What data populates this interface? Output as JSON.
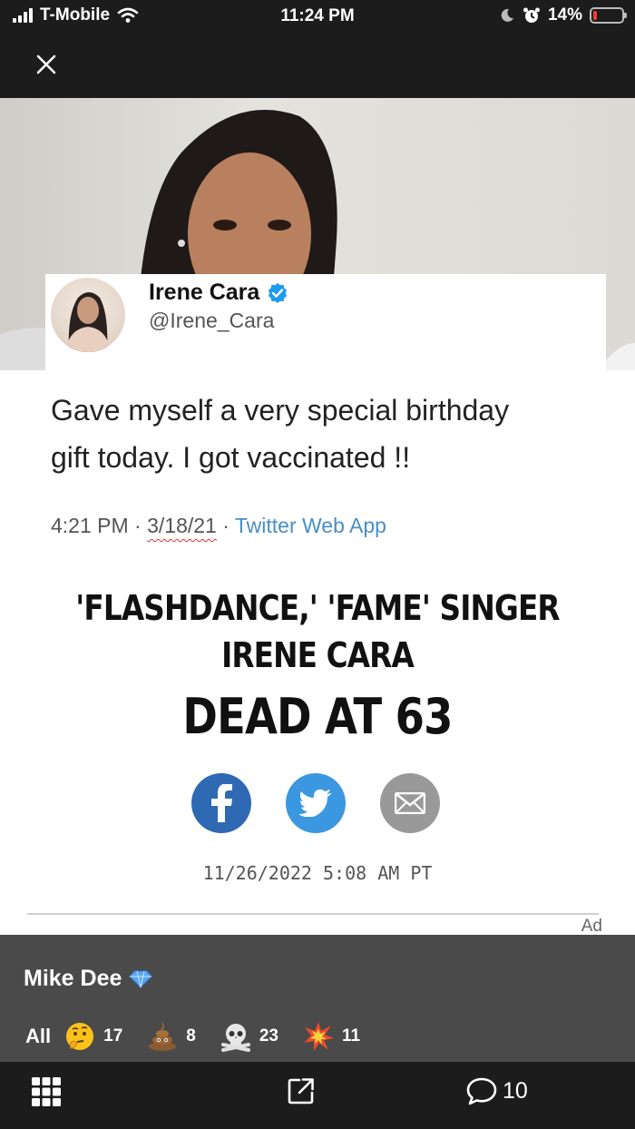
{
  "status_bar": {
    "carrier": "T-Mobile",
    "time": "11:24 PM",
    "battery_percent": "14%",
    "battery_level": 0.14
  },
  "top_bar": {
    "close_icon": "close-icon"
  },
  "image": {
    "tweet": {
      "name": "Irene Cara",
      "handle": "@Irene_Cara",
      "text_line1": "Gave myself a very special birthday",
      "text_line2": "gift today. I got vaccinated !!",
      "time": "4:21 PM",
      "sep1": " · ",
      "date": "3/18/21",
      "sep2": " · ",
      "source": "Twitter Web App"
    },
    "headline": {
      "line1": "'FLASHDANCE,' 'FAME' SINGER",
      "line2": "IRENE CARA",
      "line3": "DEAD AT 63"
    },
    "share_icons": [
      "facebook-icon",
      "twitter-icon",
      "mail-icon"
    ],
    "article_date": "11/26/2022 5:08 AM PT",
    "ad_label": "Ad"
  },
  "post": {
    "poster_name": "Mike Dee",
    "reactions_all_label": "All",
    "reactions": [
      {
        "icon": "thinking-emoji",
        "count": "17"
      },
      {
        "icon": "poop-emoji",
        "count": "8"
      },
      {
        "icon": "skull-crossbones-emoji",
        "count": "23"
      },
      {
        "icon": "collision-emoji",
        "count": "11"
      }
    ]
  },
  "bottom_nav": {
    "grid_icon": "grid-icon",
    "share_icon": "share-icon",
    "comment_count": "10"
  },
  "colors": {
    "bar_bg": "#1c1c1c",
    "panel_bg": "#4a4a4a",
    "facebook": "#2f69b3",
    "twitter": "#3b98e0",
    "battery_low": "#ff3b30"
  }
}
